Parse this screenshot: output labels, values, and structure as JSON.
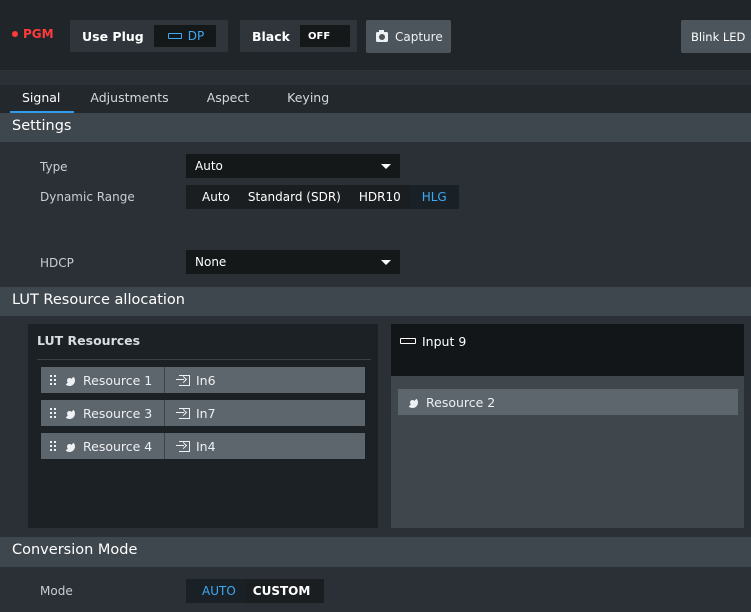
{
  "toolbar": {
    "pgm_label": "PGM",
    "use_plug_label": "Use Plug",
    "plug_value": "DP",
    "black_label": "Black",
    "black_value": "OFF",
    "capture_label": "Capture",
    "blink_led_label": "Blink LED"
  },
  "tabs": [
    {
      "label": "Signal",
      "active": true
    },
    {
      "label": "Adjustments",
      "active": false
    },
    {
      "label": "Aspect",
      "active": false
    },
    {
      "label": "Keying",
      "active": false
    }
  ],
  "settings": {
    "title": "Settings",
    "type_label": "Type",
    "type_value": "Auto",
    "dynamic_range_label": "Dynamic Range",
    "dynamic_range_options": [
      "Auto",
      "Standard (SDR)",
      "HDR10",
      "HLG"
    ],
    "dynamic_range_selected": "HLG",
    "hdcp_label": "HDCP",
    "hdcp_value": "None"
  },
  "lut": {
    "title": "LUT Resource allocation",
    "resources_title": "LUT Resources",
    "resources": [
      {
        "name": "Resource 1",
        "input": "In6"
      },
      {
        "name": "Resource 3",
        "input": "In7"
      },
      {
        "name": "Resource 4",
        "input": "In4"
      }
    ],
    "target_input": "Input 9",
    "target_resources": [
      "Resource 2"
    ]
  },
  "conversion": {
    "title": "Conversion Mode",
    "mode_label": "Mode",
    "mode_options": [
      "AUTO",
      "CUSTOM"
    ],
    "mode_selected": "AUTO"
  },
  "colors": {
    "accent": "#3da9f5",
    "pgm_red": "#ff3b3b",
    "background": "#2b3036",
    "section_header": "#3f474e"
  },
  "icons": {
    "plug": "plug-icon",
    "camera": "camera-icon",
    "grip": "drag-handle-icon",
    "lut": "lut-icon",
    "input": "input-icon"
  }
}
